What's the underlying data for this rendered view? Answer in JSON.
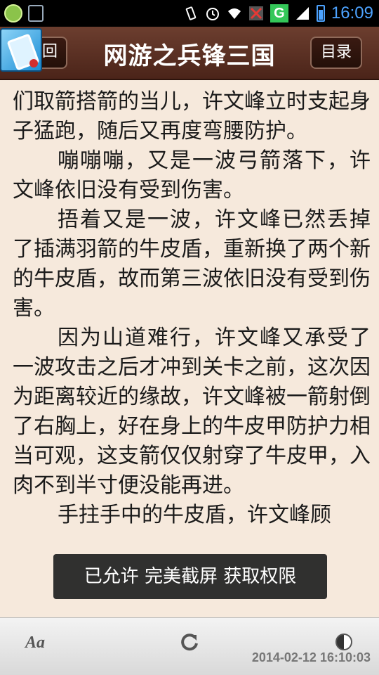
{
  "status_bar": {
    "time": "16:09",
    "network_label": "G"
  },
  "header": {
    "back_label": "回",
    "title": "网游之兵锋三国",
    "toc_label": "目录"
  },
  "content": {
    "paragraphs": [
      "们取箭搭箭的当儿，许文峰立时支起身子猛跑，随后又再度弯腰防护。",
      "嘣嘣嘣，又是一波弓箭落下，许文峰依旧没有受到伤害。",
      "捂着又是一波，许文峰已然丢掉了插满羽箭的牛皮盾，重新换了两个新的牛皮盾，故而第三波依旧没有受到伤害。",
      "因为山道难行，许文峰又承受了一波攻击之后才冲到关卡之前，这次因为距离较近的缘故，许文峰被一箭射倒了右胸上，好在身上的牛皮甲防护力相当可观，这支箭仅仅射穿了牛皮甲，入肉不到半寸便没能再进。",
      "手拄手中的牛皮盾，许文峰顾"
    ]
  },
  "toast": {
    "text": "已允许 完美截屏 获取权限"
  },
  "bottom_bar": {
    "font_label": "Aa",
    "timestamp": "2014-02-12 16:10:03"
  }
}
